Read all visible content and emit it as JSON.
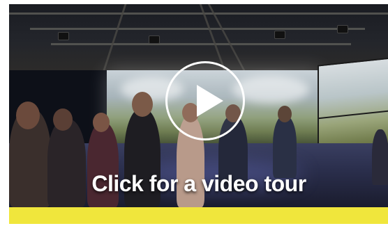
{
  "video_card": {
    "cta_label": "Click for a video tour",
    "play_icon": "play-icon",
    "accent_bar_color": "#f0e63c",
    "overlay_color": "#ffffff"
  }
}
